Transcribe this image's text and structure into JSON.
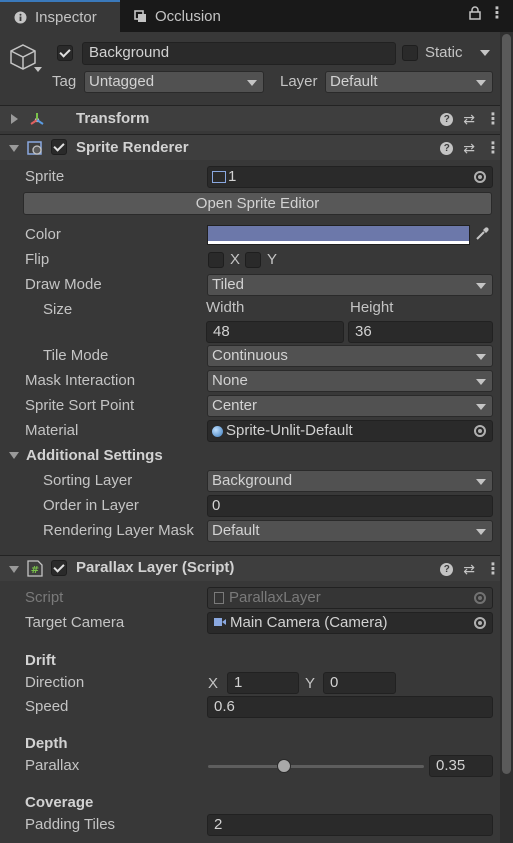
{
  "tabs": [
    {
      "label": "Inspector",
      "icon": "info-icon",
      "active": true
    },
    {
      "label": "Occlusion",
      "icon": "occlusion-icon",
      "active": false
    }
  ],
  "gameobject": {
    "name": "Background",
    "static_label": "Static",
    "tag_label": "Tag",
    "tag_value": "Untagged",
    "layer_label": "Layer",
    "layer_value": "Default"
  },
  "transform": {
    "title": "Transform"
  },
  "sprite_renderer": {
    "title": "Sprite Renderer",
    "sprite_label": "Sprite",
    "sprite_value": "1",
    "open_editor_label": "Open Sprite Editor",
    "color_label": "Color",
    "color_value": "#6c78aa",
    "flip_label": "Flip",
    "flip_x": "X",
    "flip_y": "Y",
    "draw_mode_label": "Draw Mode",
    "draw_mode_value": "Tiled",
    "size_label": "Size",
    "width_label": "Width",
    "height_label": "Height",
    "width_value": "48",
    "height_value": "36",
    "tile_mode_label": "Tile Mode",
    "tile_mode_value": "Continuous",
    "mask_label": "Mask Interaction",
    "mask_value": "None",
    "sort_point_label": "Sprite Sort Point",
    "sort_point_value": "Center",
    "material_label": "Material",
    "material_value": "Sprite-Unlit-Default",
    "additional_label": "Additional Settings",
    "sorting_layer_label": "Sorting Layer",
    "sorting_layer_value": "Background",
    "order_label": "Order in Layer",
    "order_value": "0",
    "rendering_mask_label": "Rendering Layer Mask",
    "rendering_mask_value": "Default"
  },
  "parallax": {
    "title": "Parallax Layer (Script)",
    "script_label": "Script",
    "script_value": "ParallaxLayer",
    "camera_label": "Target Camera",
    "camera_value": "Main Camera (Camera)",
    "drift_header": "Drift",
    "direction_label": "Direction",
    "dir_x_label": "X",
    "dir_x_value": "1",
    "dir_y_label": "Y",
    "dir_y_value": "0",
    "speed_label": "Speed",
    "speed_value": "0.6",
    "depth_header": "Depth",
    "parallax_label": "Parallax",
    "parallax_value": "0.35",
    "parallax_fraction": 0.35,
    "coverage_header": "Coverage",
    "padding_label": "Padding Tiles",
    "padding_value": "2"
  }
}
